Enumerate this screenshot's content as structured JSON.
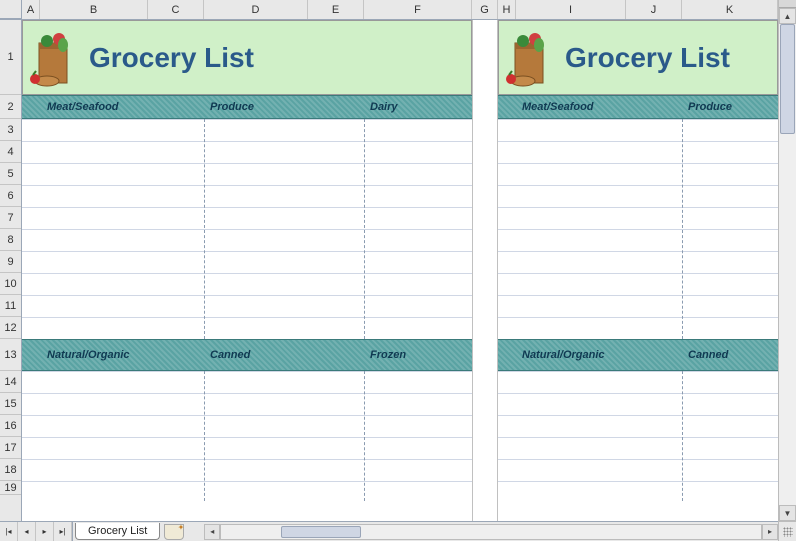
{
  "columns": [
    {
      "label": "A",
      "width": 18
    },
    {
      "label": "B",
      "width": 108
    },
    {
      "label": "C",
      "width": 56
    },
    {
      "label": "D",
      "width": 104
    },
    {
      "label": "E",
      "width": 56
    },
    {
      "label": "F",
      "width": 108
    },
    {
      "label": "G",
      "width": 26
    },
    {
      "label": "H",
      "width": 18
    },
    {
      "label": "I",
      "width": 110
    },
    {
      "label": "J",
      "width": 56
    },
    {
      "label": "K",
      "width": 96
    }
  ],
  "rows": [
    {
      "n": "1",
      "h": 75
    },
    {
      "n": "2",
      "h": 24
    },
    {
      "n": "3",
      "h": 22
    },
    {
      "n": "4",
      "h": 22
    },
    {
      "n": "5",
      "h": 22
    },
    {
      "n": "6",
      "h": 22
    },
    {
      "n": "7",
      "h": 22
    },
    {
      "n": "8",
      "h": 22
    },
    {
      "n": "9",
      "h": 22
    },
    {
      "n": "10",
      "h": 22
    },
    {
      "n": "11",
      "h": 22
    },
    {
      "n": "12",
      "h": 22
    },
    {
      "n": "13",
      "h": 32
    },
    {
      "n": "14",
      "h": 22
    },
    {
      "n": "15",
      "h": 22
    },
    {
      "n": "16",
      "h": 22
    },
    {
      "n": "17",
      "h": 22
    },
    {
      "n": "18",
      "h": 22
    },
    {
      "n": "19",
      "h": 14
    }
  ],
  "title": "Grocery List",
  "categories_left_top": [
    "Meat/Seafood",
    "Produce",
    "Dairy"
  ],
  "categories_left_bottom": [
    "Natural/Organic",
    "Canned",
    "Frozen"
  ],
  "categories_right_top": [
    "Meat/Seafood",
    "Produce"
  ],
  "categories_right_bottom": [
    "Natural/Organic",
    "Canned"
  ],
  "sheet_tab": "Grocery List"
}
